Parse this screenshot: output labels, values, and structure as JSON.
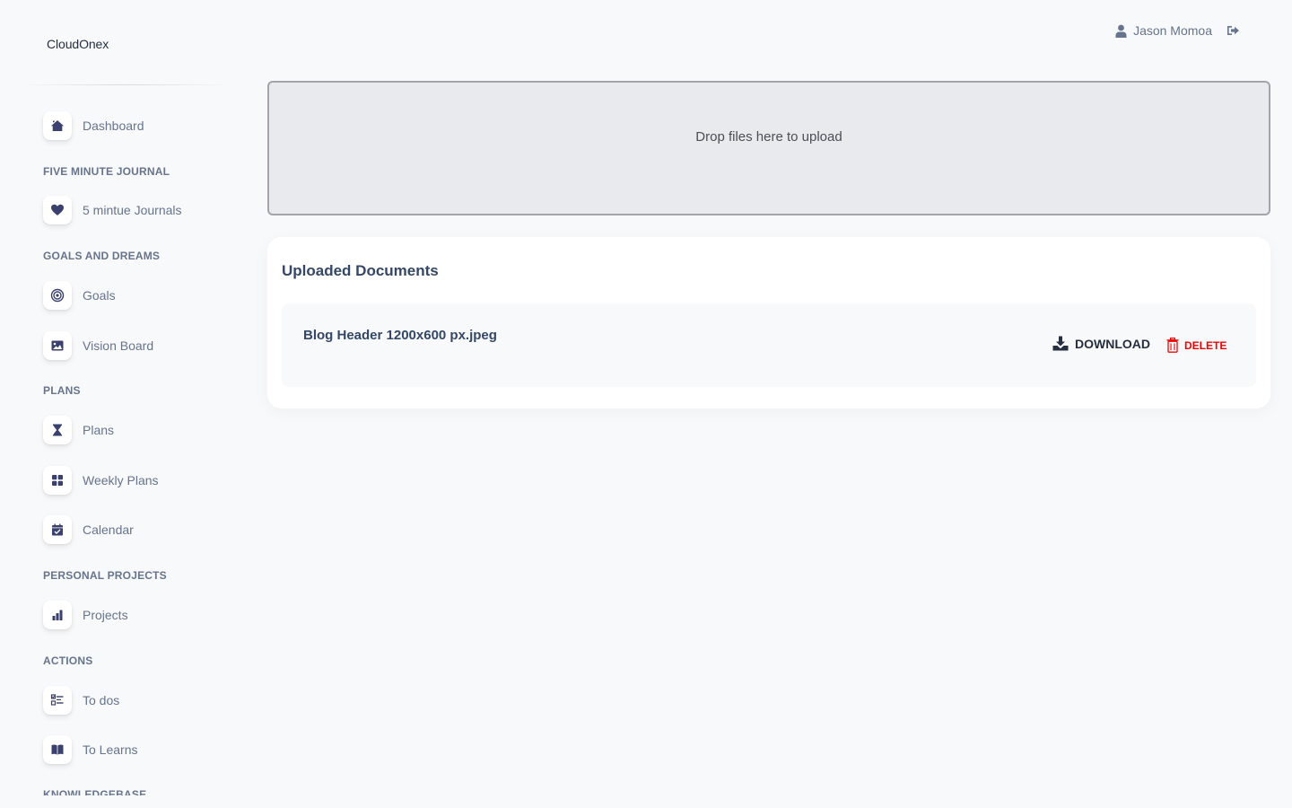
{
  "brand": "CloudOnex",
  "user": {
    "name": "Jason Momoa",
    "user_icon": "user-icon",
    "logout_icon": "sign-out-icon"
  },
  "sidebar": {
    "items": [
      {
        "type": "item",
        "label": "Dashboard",
        "icon": "home-icon"
      },
      {
        "type": "section",
        "label": "FIVE MINUTE JOURNAL"
      },
      {
        "type": "item",
        "label": "5 mintue Journals",
        "icon": "heart-icon"
      },
      {
        "type": "section",
        "label": "GOALS AND DREAMS"
      },
      {
        "type": "item",
        "label": "Goals",
        "icon": "target-icon"
      },
      {
        "type": "item",
        "label": "Vision Board",
        "icon": "image-icon"
      },
      {
        "type": "section",
        "label": "PLANS"
      },
      {
        "type": "item",
        "label": "Plans",
        "icon": "hourglass-icon"
      },
      {
        "type": "item",
        "label": "Weekly Plans",
        "icon": "grid-icon"
      },
      {
        "type": "item",
        "label": "Calendar",
        "icon": "calendar-check-icon"
      },
      {
        "type": "section",
        "label": "PERSONAL PROJECTS"
      },
      {
        "type": "item",
        "label": "Projects",
        "icon": "bar-chart-icon"
      },
      {
        "type": "section",
        "label": "ACTIONS"
      },
      {
        "type": "item",
        "label": "To dos",
        "icon": "checklist-icon"
      },
      {
        "type": "item",
        "label": "To Learns",
        "icon": "book-icon"
      },
      {
        "type": "section",
        "label": "KNOWLEDGEBASE"
      }
    ]
  },
  "dropzone": {
    "text": "Drop files here to upload"
  },
  "documents": {
    "title": "Uploaded Documents",
    "rows": [
      {
        "name": "Blog Header 1200x600 px.jpeg",
        "download_label": "DOWNLOAD",
        "delete_label": "DELETE"
      }
    ]
  },
  "colors": {
    "text": "#344767",
    "muted": "#67748e",
    "danger": "#ea0606",
    "icon": "#3a416f"
  }
}
